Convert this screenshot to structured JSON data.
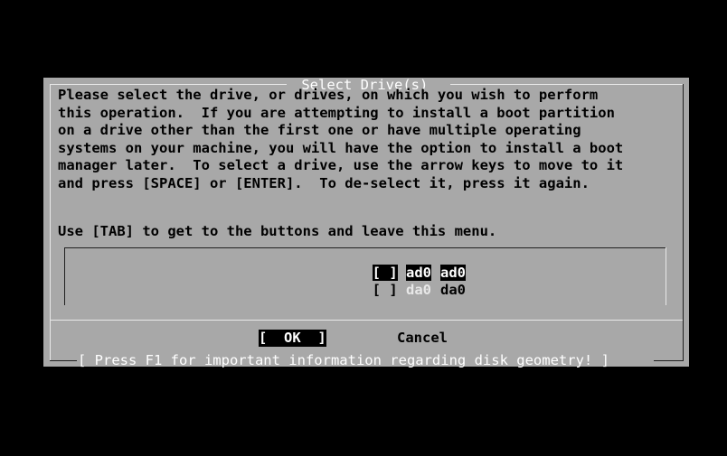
{
  "dialog": {
    "title": " Select Drive(s) ",
    "instructions": [
      "Please select the drive, or drives, on which you wish to perform",
      "this operation.  If you are attempting to install a boot partition",
      "on a drive other than the first one or have multiple operating",
      "systems on your machine, you will have the option to install a boot",
      "manager later.  To select a drive, use the arrow keys to move to it",
      "and press [SPACE] or [ENTER].  To de-select it, press it again."
    ],
    "tab_hint": "Use [TAB] to get to the buttons and leave this menu.",
    "drives": [
      {
        "checkbox": "[ ]",
        "name": "ad0",
        "description": "ad0",
        "highlighted": true,
        "checked": false
      },
      {
        "checkbox": "[ ]",
        "name": "da0",
        "description": "da0",
        "highlighted": false,
        "checked": false
      }
    ],
    "buttons": {
      "ok": "[  OK  ]",
      "cancel": "Cancel"
    },
    "footer_hint": "[ Press F1 for important information regarding disk geometry! ]"
  },
  "colors": {
    "screen_background": "#000000",
    "dialog_background": "#a8a8a8",
    "highlight_background": "#000000",
    "highlight_text": "#ffffff",
    "frame_light": "#e8e8e8",
    "frame_dark": "#202020"
  }
}
